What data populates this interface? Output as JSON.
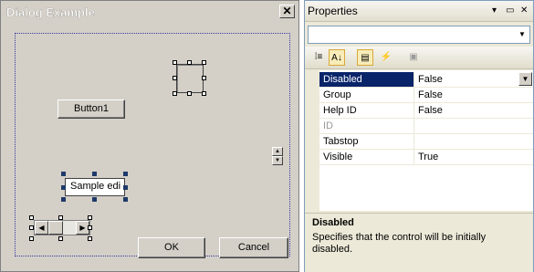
{
  "dialog": {
    "title": "Dialog Example",
    "close_glyph": "✕",
    "button1_label": "Button1",
    "edit_text": "Sample edi",
    "ok_label": "OK",
    "cancel_label": "Cancel",
    "spin_up_glyph": "▲",
    "spin_down_glyph": "▼",
    "scroll_left_glyph": "◀",
    "scroll_right_glyph": "▶"
  },
  "properties": {
    "title": "Properties",
    "title_buttons": {
      "dropdown": "▾",
      "pin": "▭",
      "close": "✕"
    },
    "object_combo_value": "",
    "object_combo_arrow": "▼",
    "toolbar": [
      {
        "name": "categorized-icon",
        "glyph": "⁞≡",
        "selected": false
      },
      {
        "name": "alphabetical-icon",
        "glyph": "A↓",
        "selected": true
      },
      {
        "name": "properties-icon",
        "glyph": "▤",
        "selected": true
      },
      {
        "name": "events-icon",
        "glyph": "⚡",
        "selected": false
      },
      {
        "name": "property-pages-icon",
        "glyph": "▣",
        "selected": false
      }
    ],
    "rows": [
      {
        "key": "Disabled",
        "value": "False",
        "selected": true,
        "dimmed": false,
        "has_dropdown": true
      },
      {
        "key": "Group",
        "value": "False",
        "selected": false,
        "dimmed": false,
        "has_dropdown": false
      },
      {
        "key": "Help ID",
        "value": "False",
        "selected": false,
        "dimmed": false,
        "has_dropdown": false
      },
      {
        "key": "ID",
        "value": "",
        "selected": false,
        "dimmed": true,
        "has_dropdown": false
      },
      {
        "key": "Tabstop",
        "value": "",
        "selected": false,
        "dimmed": false,
        "has_dropdown": false
      },
      {
        "key": "Visible",
        "value": "True",
        "selected": false,
        "dimmed": false,
        "has_dropdown": false
      }
    ],
    "dropdown_glyph": "▼",
    "description": {
      "title": "Disabled",
      "text": "Specifies that the control will be initially disabled."
    }
  },
  "colors": {
    "dialog_face": "#d4d0c8",
    "selection": "#0a246a",
    "pane_face": "#ece9d8"
  }
}
